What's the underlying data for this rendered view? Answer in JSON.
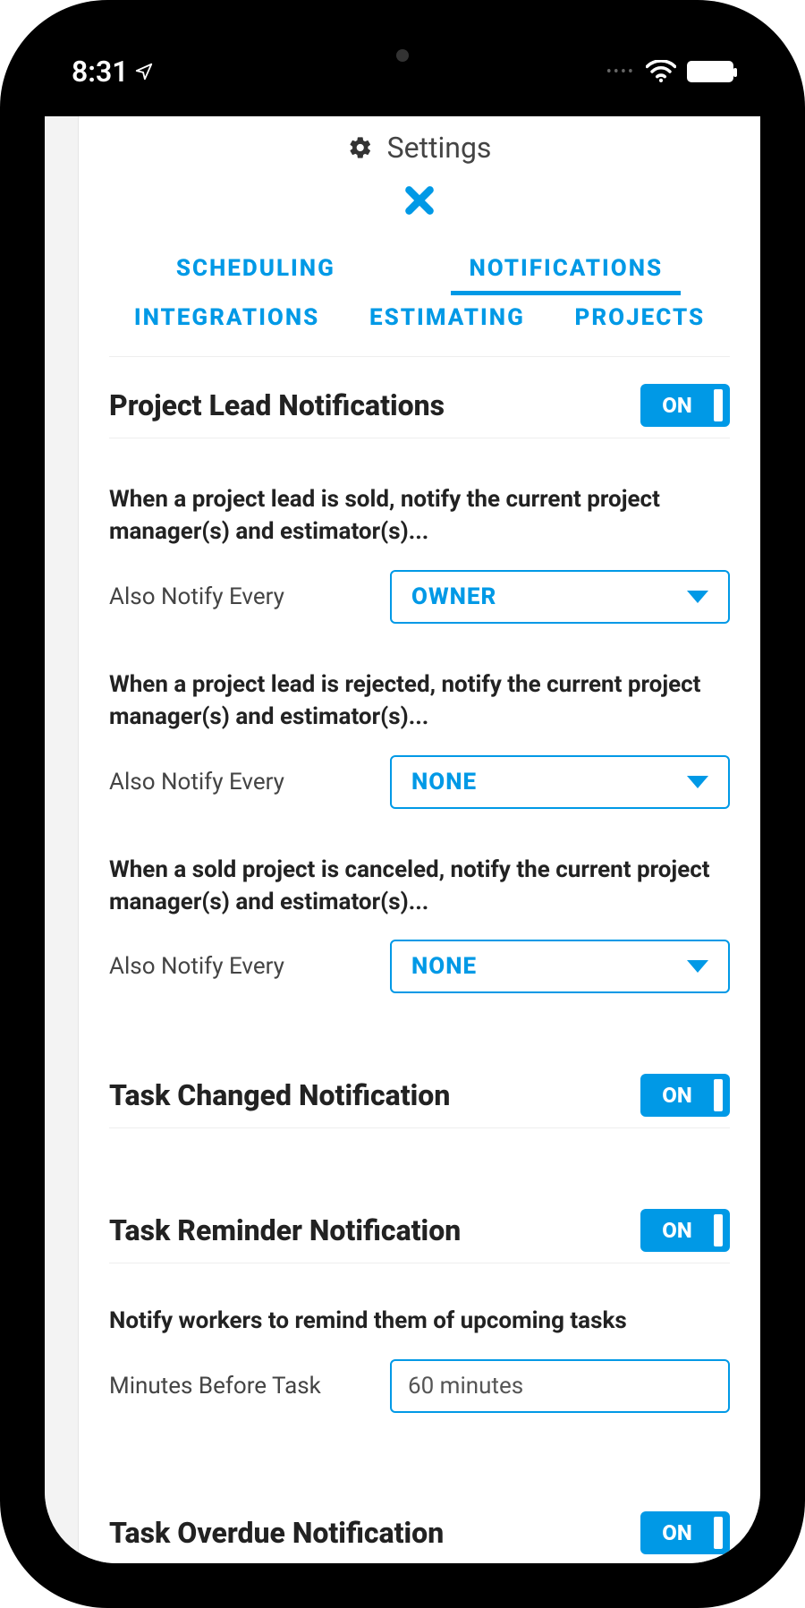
{
  "status": {
    "time": "8:31"
  },
  "header": {
    "title": "Settings"
  },
  "tabs": [
    "SCHEDULING",
    "NOTIFICATIONS",
    "INTEGRATIONS",
    "ESTIMATING",
    "PROJECTS"
  ],
  "active_tab": "NOTIFICATIONS",
  "toggle_on_label": "ON",
  "sections": {
    "project_lead": {
      "title": "Project Lead Notifications",
      "on": true,
      "items": [
        {
          "desc": "When a project lead is sold, notify the current project manager(s) and estimator(s)...",
          "label": "Also Notify Every",
          "value": "OWNER"
        },
        {
          "desc": "When a project lead is rejected, notify the current project manager(s) and estimator(s)...",
          "label": "Also Notify Every",
          "value": "NONE"
        },
        {
          "desc": "When a sold project is canceled, notify the current project manager(s) and estimator(s)...",
          "label": "Also Notify Every",
          "value": "NONE"
        }
      ]
    },
    "task_changed": {
      "title": "Task Changed Notification",
      "on": true
    },
    "task_reminder": {
      "title": "Task Reminder Notification",
      "on": true,
      "desc": "Notify workers to remind them of upcoming tasks",
      "field_label": "Minutes Before Task",
      "field_value": "60 minutes"
    },
    "task_overdue": {
      "title": "Task Overdue Notification",
      "on": true
    }
  }
}
